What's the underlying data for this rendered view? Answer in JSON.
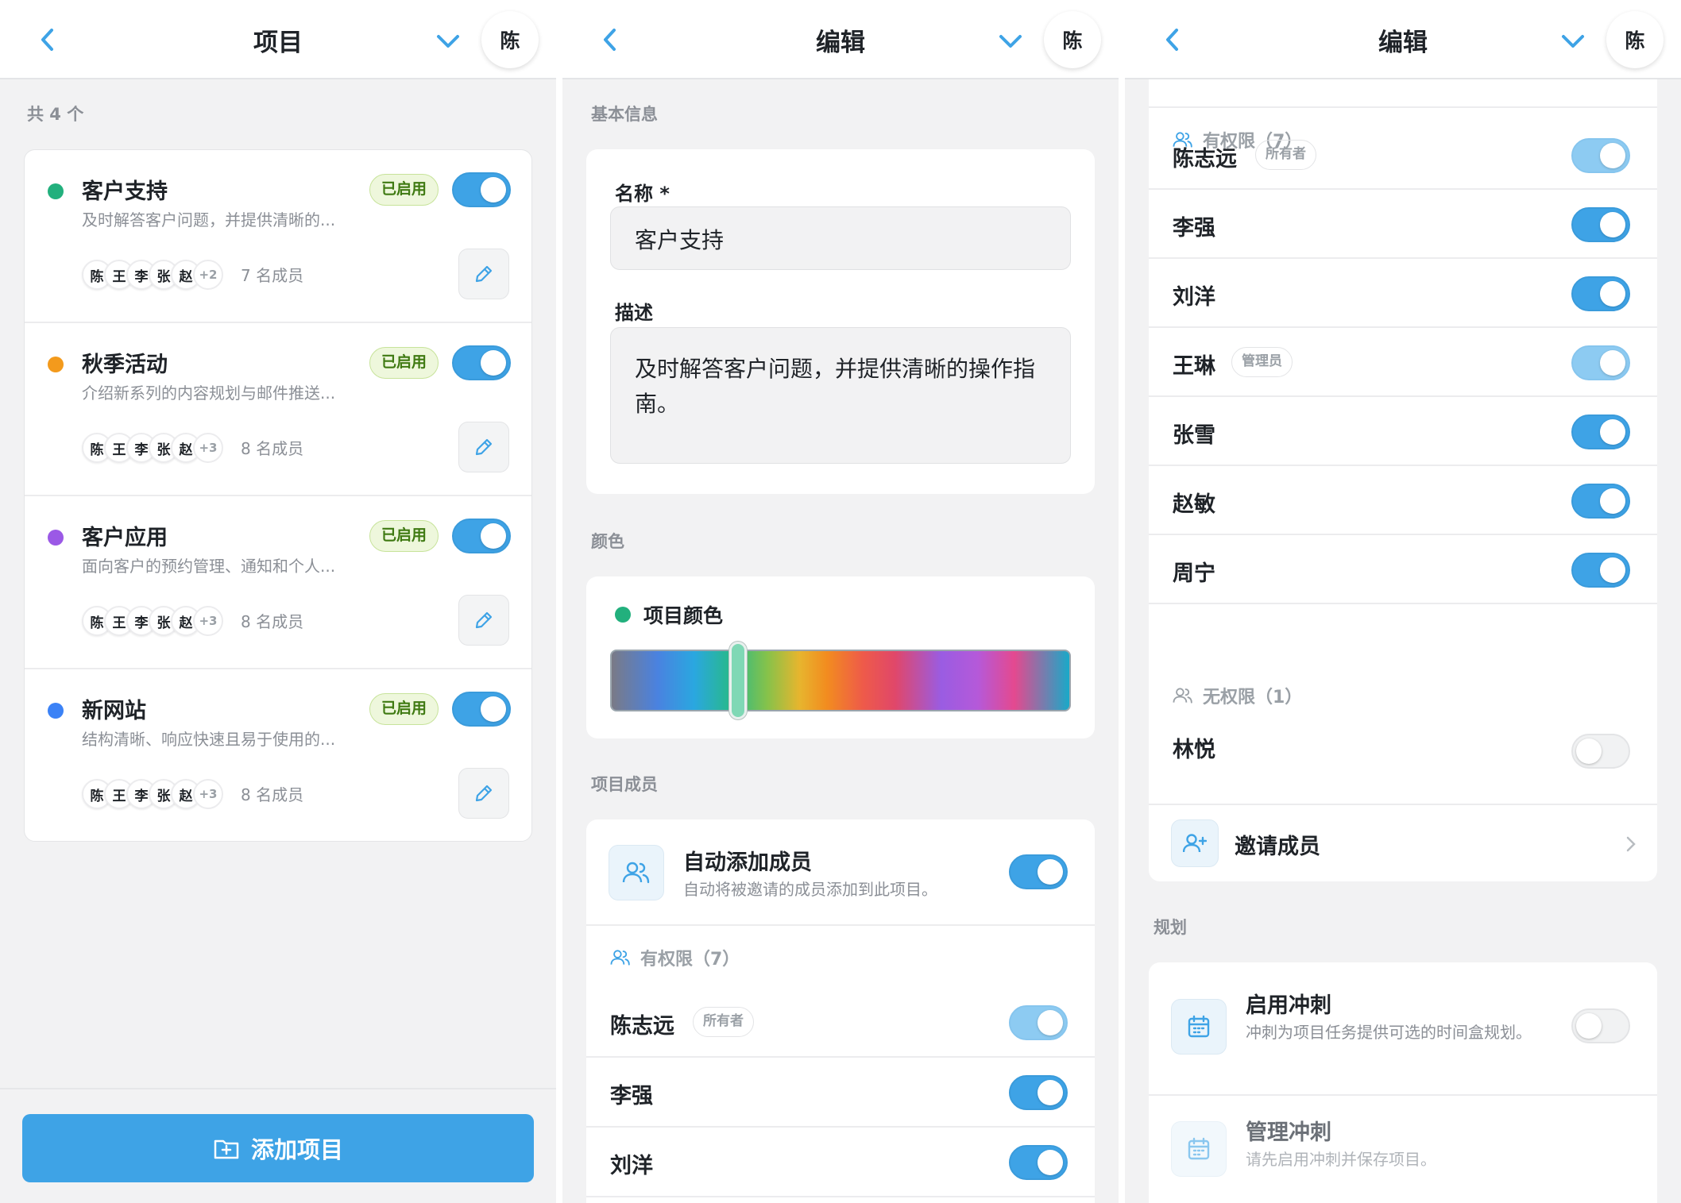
{
  "colors": {
    "accent": "#3ea3e6",
    "enabled_badge_bg": "#eef7dc",
    "enabled_badge_text": "#3f7a12"
  },
  "panel1": {
    "header": {
      "title": "项目",
      "avatar": "陈"
    },
    "count_label": "共 4 个",
    "projects": [
      {
        "name": "客户支持",
        "dot_color": "#22b07d",
        "description": "及时解答客户问题，并提供清晰的...",
        "status": "已启用",
        "enabled": true,
        "avatars": [
          "陈",
          "王",
          "李",
          "张",
          "赵"
        ],
        "more": "+2",
        "members": "7 名成员"
      },
      {
        "name": "秋季活动",
        "dot_color": "#f39a1c",
        "description": "介绍新系列的内容规划与邮件推送...",
        "status": "已启用",
        "enabled": true,
        "avatars": [
          "陈",
          "王",
          "李",
          "张",
          "赵"
        ],
        "more": "+3",
        "members": "8 名成员"
      },
      {
        "name": "客户应用",
        "dot_color": "#9b59e6",
        "description": "面向客户的预约管理、通知和个人...",
        "status": "已启用",
        "enabled": true,
        "avatars": [
          "陈",
          "王",
          "李",
          "张",
          "赵"
        ],
        "more": "+3",
        "members": "8 名成员"
      },
      {
        "name": "新网站",
        "dot_color": "#3b82f6",
        "description": "结构清晰、响应快速且易于使用的...",
        "status": "已启用",
        "enabled": true,
        "avatars": [
          "陈",
          "王",
          "李",
          "张",
          "赵"
        ],
        "more": "+3",
        "members": "8 名成员"
      }
    ],
    "add_button": "添加项目"
  },
  "panel2": {
    "header": {
      "title": "编辑",
      "avatar": "陈"
    },
    "basic_section": "基本信息",
    "name_label": "名称 *",
    "name_value": "客户支持",
    "desc_label": "描述",
    "desc_value": "及时解答客户问题，并提供清晰的操作指南。",
    "color_section": "颜色",
    "color_label": "项目颜色",
    "members_section": "项目成员",
    "auto_add": {
      "title": "自动添加成员",
      "subtitle": "自动将被邀请的成员添加到此项目。",
      "enabled": true
    },
    "permitted_group": "有权限（7）",
    "members": [
      {
        "name": "陈志远",
        "role": "所有者",
        "toggle": "light"
      },
      {
        "name": "李强",
        "role": "",
        "toggle": "on"
      },
      {
        "name": "刘洋",
        "role": "",
        "toggle": "on"
      }
    ]
  },
  "panel3": {
    "header": {
      "title": "编辑",
      "avatar": "陈"
    },
    "permitted_group": "有权限（7）",
    "members": [
      {
        "name": "陈志远",
        "role": "所有者",
        "toggle": "light"
      },
      {
        "name": "李强",
        "role": "",
        "toggle": "on"
      },
      {
        "name": "刘洋",
        "role": "",
        "toggle": "on"
      },
      {
        "name": "王琳",
        "role": "管理员",
        "toggle": "light"
      },
      {
        "name": "张雪",
        "role": "",
        "toggle": "on"
      },
      {
        "name": "赵敏",
        "role": "",
        "toggle": "on"
      },
      {
        "name": "周宁",
        "role": "",
        "toggle": "on"
      }
    ],
    "unpermitted_group": "无权限（1）",
    "unpermitted_members": [
      {
        "name": "林悦",
        "role": "",
        "toggle": "off"
      }
    ],
    "invite_label": "邀请成员",
    "planning_section": "规划",
    "sprint_enable": {
      "title": "启用冲刺",
      "subtitle": "冲刺为项目任务提供可选的时间盒规划。",
      "enabled": false
    },
    "sprint_manage": {
      "title": "管理冲刺",
      "subtitle": "请先启用冲刺并保存项目。"
    }
  }
}
